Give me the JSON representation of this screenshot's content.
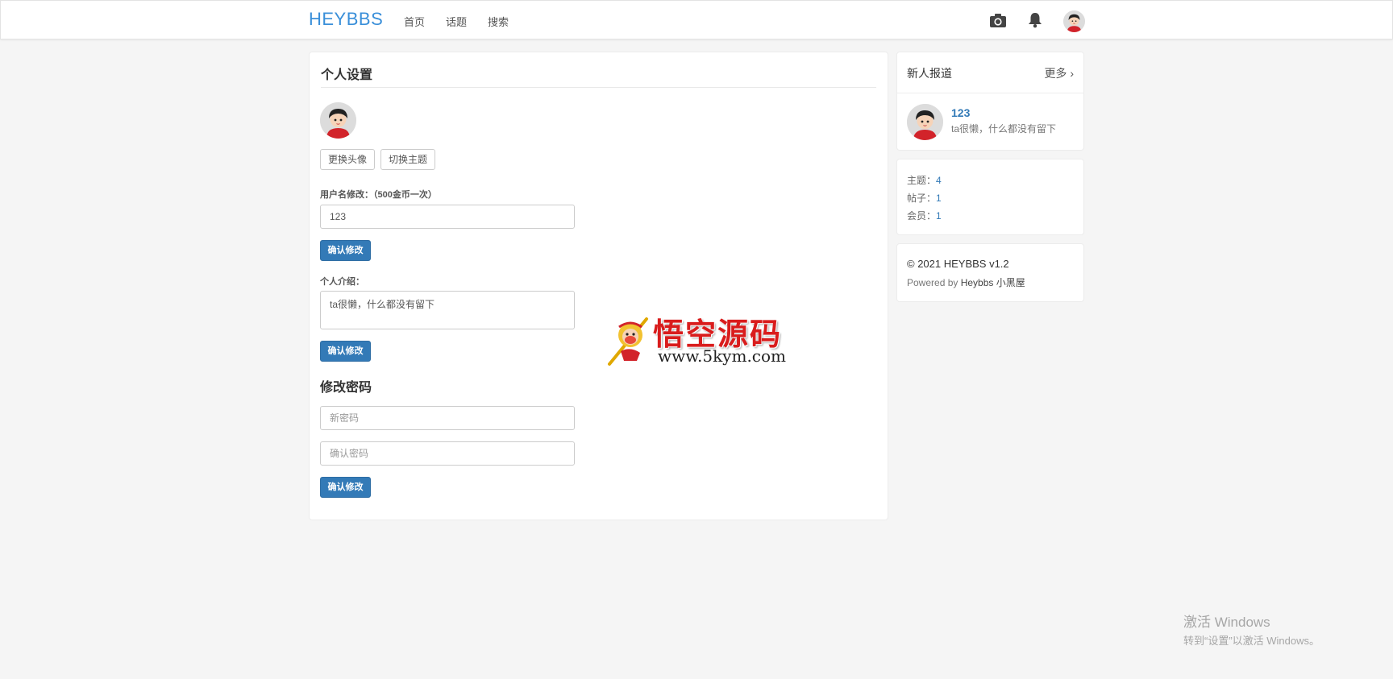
{
  "navbar": {
    "brand": "HEYBBS",
    "links": [
      "首页",
      "话题",
      "搜索"
    ]
  },
  "settings": {
    "title": "个人设置",
    "change_avatar": "更换头像",
    "switch_theme": "切换主题",
    "username_label": "用户名修改：（500金币一次）",
    "username_value": "123",
    "confirm_label": "确认修改",
    "intro_label": "个人介绍：",
    "intro_value": "ta很懒，什么都没有留下",
    "password_title": "修改密码",
    "new_password_placeholder": "新密码",
    "confirm_password_placeholder": "确认密码"
  },
  "sidebar": {
    "new_users": {
      "title": "新人报道",
      "more": "更多 ›",
      "user_name": "123",
      "user_bio": "ta很懒，什么都没有留下"
    },
    "stats": [
      {
        "label": "主题：",
        "value": "4"
      },
      {
        "label": "帖子：",
        "value": "1"
      },
      {
        "label": "会员：",
        "value": "1"
      }
    ],
    "footer": {
      "copyright": "© 2021 HEYBBS v1.2",
      "powered_prefix": "Powered by",
      "powered_by": "Heybbs 小黑屋"
    }
  },
  "watermark": {
    "title": "悟空源码",
    "url": "www.5kym.com"
  },
  "windows_activation": {
    "line1": "激活 Windows",
    "line2": "转到“设置”以激活 Windows。"
  },
  "colors": {
    "brand": "#3a8fd9",
    "primary": "#337ab7",
    "background": "#f5f5f5"
  }
}
